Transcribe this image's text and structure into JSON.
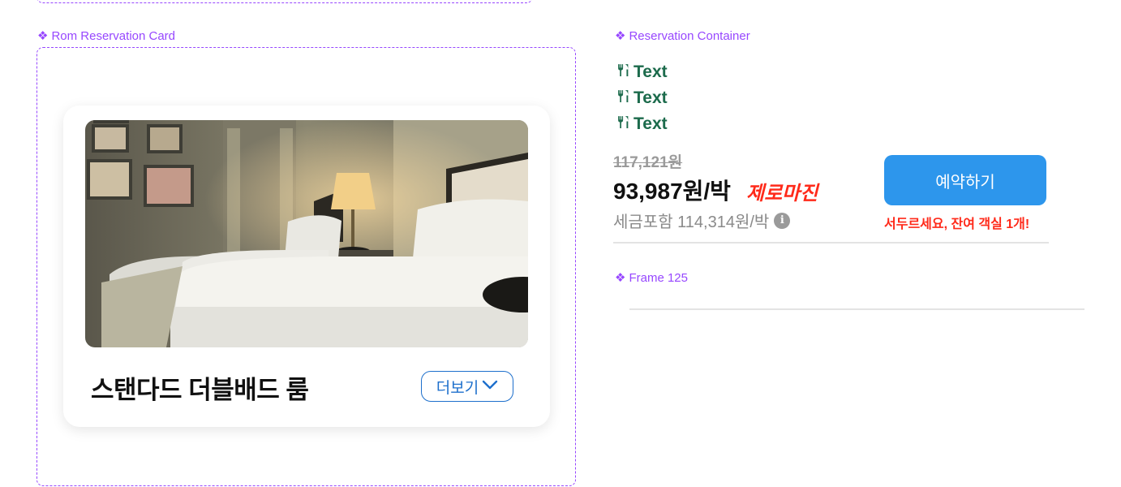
{
  "components": {
    "room_card_label": "Rom Reservation Card",
    "reservation_container_label": "Reservation Container",
    "frame_label": "Frame 125",
    "diamond_glyph": "❖"
  },
  "room": {
    "name": "스탠다드 더블배드 룸",
    "more_label": "더보기"
  },
  "amenities": [
    {
      "label": "Text",
      "icon": "fork-knife-icon"
    },
    {
      "label": "Text",
      "icon": "fork-knife-icon"
    },
    {
      "label": "Text",
      "icon": "fork-knife-icon"
    }
  ],
  "pricing": {
    "original": "117,121원",
    "current": "93,987원/박",
    "badge": "제로마진",
    "tax_included": "세금포함 114,314원/박",
    "info_glyph": "i"
  },
  "reserve": {
    "button_label": "예약하기",
    "urgency": "서두르세요, 잔여 객실 1개!"
  },
  "colors": {
    "component_purple": "#9747ff",
    "amenity_green": "#1c6b4c",
    "accent_blue": "#2d96ec",
    "alert_red": "#ff2a1a"
  }
}
